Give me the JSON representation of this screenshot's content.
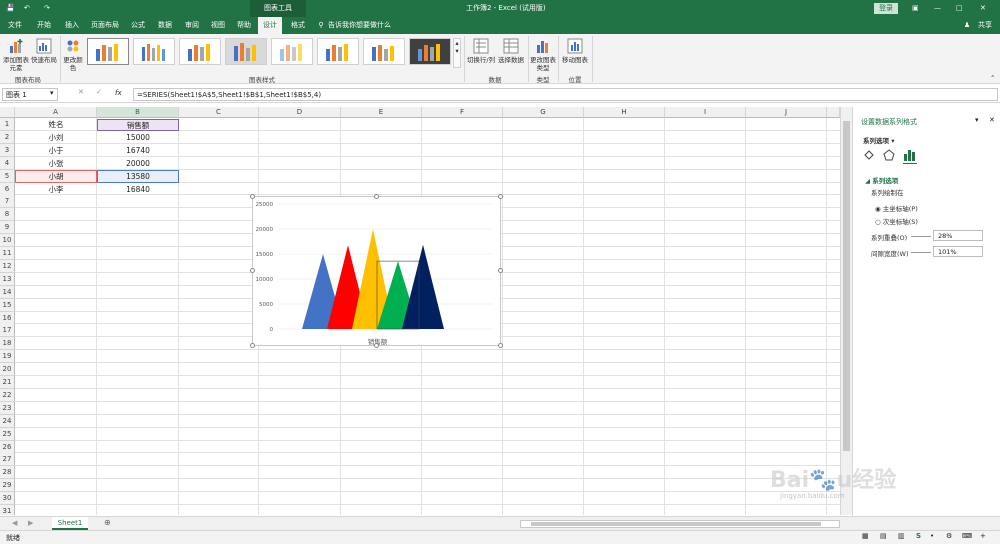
{
  "app": {
    "title": "工作簿2 - Excel (试用版)",
    "context_tab": "图表工具",
    "login": "登录",
    "share": "共享",
    "search": "告诉我你想要做什么"
  },
  "tabs": [
    "文件",
    "开始",
    "插入",
    "页面布局",
    "公式",
    "数据",
    "审阅",
    "视图",
    "帮助",
    "设计",
    "格式"
  ],
  "active_tab": "设计",
  "ribbon": {
    "add_element": "添加图表元素",
    "quick_layout": "快速布局",
    "change_color": "更改颜色",
    "switch_rowcol": "切换行/列",
    "select_data": "选择数据",
    "change_type": "更改图表类型",
    "move_chart": "移动图表",
    "group_layout": "图表布局",
    "group_styles": "图表样式",
    "group_data": "数据",
    "group_type": "类型",
    "group_location": "位置"
  },
  "formula_bar": {
    "name_box": "图表 1",
    "fx": "fx",
    "formula": "=SERIES(Sheet1!$A$5,Sheet1!$B$1,Sheet1!$B$5,4)"
  },
  "columns": [
    "A",
    "B",
    "C",
    "D",
    "E",
    "F",
    "G",
    "H",
    "I",
    "J"
  ],
  "rows": [
    "1",
    "2",
    "3",
    "4",
    "5",
    "6",
    "7",
    "8",
    "9",
    "10",
    "11",
    "12",
    "13",
    "14",
    "15",
    "16",
    "17",
    "18",
    "19",
    "20",
    "21",
    "22",
    "23",
    "24",
    "25",
    "26",
    "27",
    "28",
    "29",
    "30",
    "31"
  ],
  "table": {
    "headers": [
      "姓名",
      "销售额"
    ],
    "rows": [
      [
        "小刘",
        "15000"
      ],
      [
        "小于",
        "16740"
      ],
      [
        "小张",
        "20000"
      ],
      [
        "小胡",
        "13580"
      ],
      [
        "小李",
        "16840"
      ]
    ]
  },
  "chart_data": {
    "type": "bar",
    "categories": [
      "小刘",
      "小于",
      "小张",
      "小胡",
      "小李"
    ],
    "values": [
      15000,
      16740,
      20000,
      13580,
      16840
    ],
    "xlabel": "销售额",
    "ylim": [
      0,
      25000
    ],
    "y_ticks": [
      "25000",
      "20000",
      "15000",
      "10000",
      "5000",
      "0"
    ],
    "colors": [
      "#4472c4",
      "#ff0000",
      "#ffc000",
      "#00b050",
      "#002060"
    ],
    "grid": true,
    "shape": "triangle"
  },
  "pane": {
    "title": "设置数据系列格式",
    "options_label": "系列选项",
    "section": "系列选项",
    "plot_on": "系列绘制在",
    "primary_axis": "主坐标轴(P)",
    "secondary_axis": "次坐标轴(S)",
    "overlap_label": "系列重叠(O)",
    "overlap_value": "28%",
    "gap_label": "间隙宽度(W)",
    "gap_value": "101%"
  },
  "sheet": {
    "tab": "Sheet1"
  },
  "status": {
    "ready": "就绪"
  },
  "watermark": "Baidu经验 jingyan.baidu.com"
}
